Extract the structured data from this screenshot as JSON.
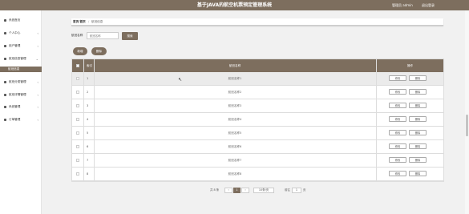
{
  "header": {
    "title": "基于JAVA的航空机票预定管理系统",
    "user": "管理员 admin",
    "logout": "退出登录"
  },
  "sidebar": {
    "items": [
      {
        "label": "系统首页",
        "icon": "home-icon",
        "arrow": ""
      },
      {
        "label": "个人中心",
        "icon": "user-icon",
        "arrow": "‹"
      },
      {
        "label": "用户管理",
        "icon": "users-icon",
        "arrow": "‹"
      },
      {
        "label": "航班信息管理",
        "icon": "plane-icon",
        "arrow": "⌄"
      },
      {
        "label": "航班分类管理",
        "icon": "grid-icon",
        "arrow": "‹"
      },
      {
        "label": "航班详情管理",
        "icon": "list-icon",
        "arrow": "‹"
      },
      {
        "label": "系统管理",
        "icon": "gear-icon",
        "arrow": "‹"
      },
      {
        "label": "订单管理",
        "icon": "order-icon",
        "arrow": "‹"
      }
    ],
    "active_sub": "航班信息"
  },
  "breadcrumb": {
    "root": "首页/首页",
    "separator": "/",
    "current": "航班信息"
  },
  "search": {
    "label": "航班名称",
    "placeholder": "航班名称",
    "button": "搜索"
  },
  "actions": {
    "add": "新增",
    "delete": "删除"
  },
  "table": {
    "columns": [
      "索引",
      "航班名称",
      "操作"
    ],
    "rows": [
      {
        "index": "1",
        "name": "航班名称1"
      },
      {
        "index": "2",
        "name": "航班名称2"
      },
      {
        "index": "3",
        "name": "航班名称3"
      },
      {
        "index": "4",
        "name": "航班名称4"
      },
      {
        "index": "5",
        "name": "航班名称5"
      },
      {
        "index": "6",
        "name": "航班名称6"
      },
      {
        "index": "7",
        "name": "航班名称7"
      },
      {
        "index": "8",
        "name": "航班名称8"
      }
    ],
    "edit_label": "修改",
    "delete_label": "删除"
  },
  "pagination": {
    "total": "共 8 条",
    "prev": "‹",
    "current": "1",
    "next": "›",
    "page_size": "10条/页",
    "goto_label": "前往",
    "goto_value": "1",
    "page_unit": "页"
  },
  "colors": {
    "brand": "#7d6e5e",
    "row_highlight": "#ebebeb"
  }
}
